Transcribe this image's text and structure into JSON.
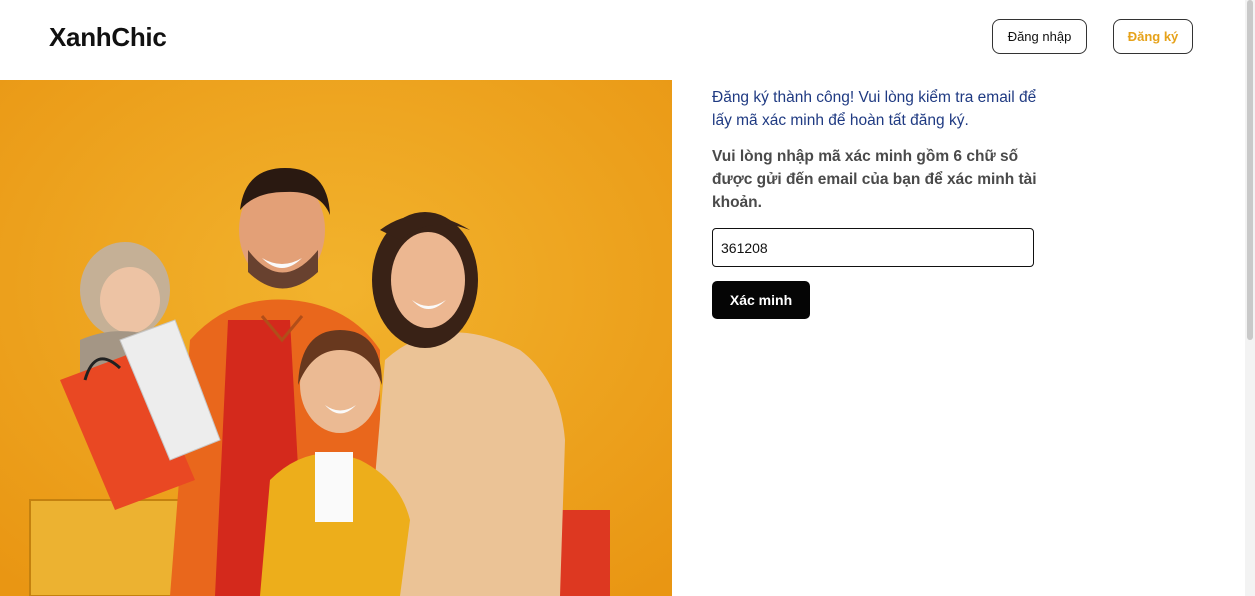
{
  "header": {
    "logo": "XanhChic",
    "login_label": "Đăng nhập",
    "register_label": "Đăng ký"
  },
  "hero": {
    "icon": "family-shopping-photo",
    "background_color": "#f4a81f"
  },
  "verification": {
    "success_message": "Đăng ký thành công! Vui lòng kiểm tra email để lấy mã xác minh để hoàn tất đăng ký.",
    "instruction": "Vui lòng nhập mã xác minh gồm 6 chữ số được gửi đến email của bạn để xác minh tài khoản.",
    "code_value": "361208",
    "verify_label": "Xác minh"
  },
  "colors": {
    "accent": "#e6a21a",
    "success_text": "#1f3a82",
    "button_bg": "#050505"
  }
}
